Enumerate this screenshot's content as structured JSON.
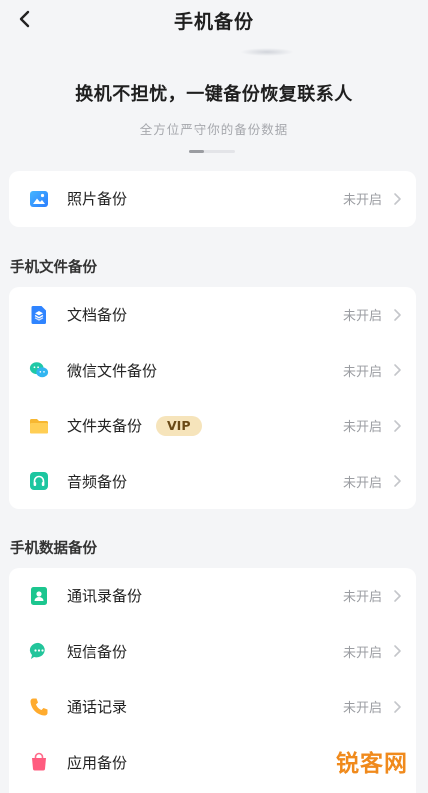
{
  "header": {
    "title": "手机备份"
  },
  "hero": {
    "title": "换机不担忧，一键备份恢复联系人",
    "subtitle": "全方位严守你的备份数据",
    "carousel_progress": 0.33
  },
  "photo_card": {
    "items": [
      {
        "label": "照片备份",
        "status": "未开启",
        "icon": "photo-icon"
      }
    ]
  },
  "file_section": {
    "title": "手机文件备份",
    "items": [
      {
        "label": "文档备份",
        "status": "未开启",
        "icon": "document-icon"
      },
      {
        "label": "微信文件备份",
        "status": "未开启",
        "icon": "wechat-icon"
      },
      {
        "label": "文件夹备份",
        "status": "未开启",
        "icon": "folder-icon",
        "badge": "VIP"
      },
      {
        "label": "音频备份",
        "status": "未开启",
        "icon": "headphones-icon"
      }
    ]
  },
  "data_section": {
    "title": "手机数据备份",
    "items": [
      {
        "label": "通讯录备份",
        "status": "未开启",
        "icon": "contacts-icon"
      },
      {
        "label": "短信备份",
        "status": "未开启",
        "icon": "message-icon"
      },
      {
        "label": "通话记录",
        "status": "未开启",
        "icon": "phone-icon"
      },
      {
        "label": "应用备份",
        "status": "",
        "icon": "app-bag-icon"
      }
    ]
  },
  "watermark": {
    "text": "锐客网"
  },
  "colors": {
    "background": "#f4f5f7",
    "card": "#ffffff",
    "status_text": "#9b9da2",
    "vip_badge_bg": "#f6e4bb",
    "vip_badge_text": "#6a4a17",
    "watermark": "#f08a1c"
  }
}
